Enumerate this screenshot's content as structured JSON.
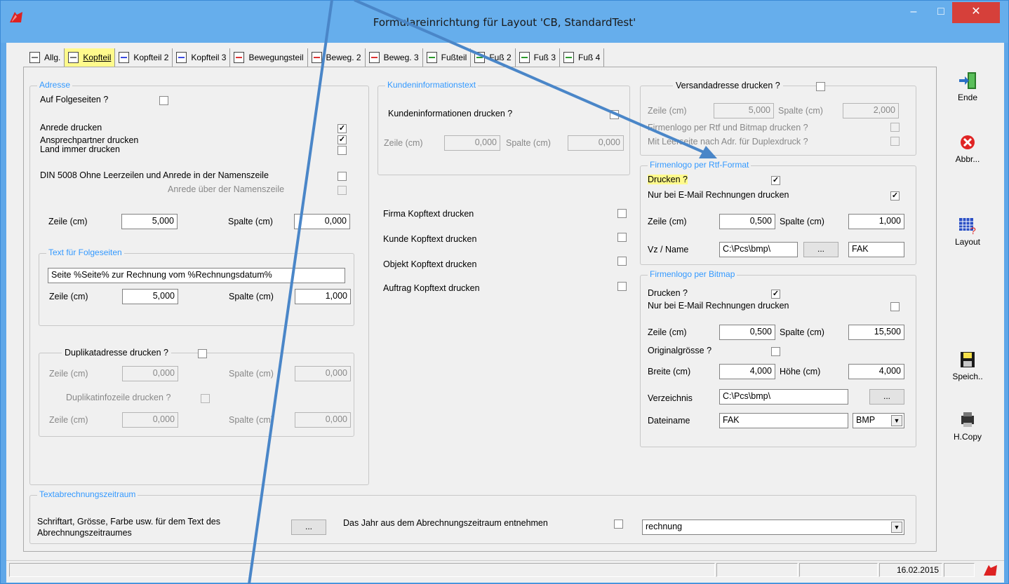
{
  "window": {
    "title": "Formulareinrichtung für Layout 'CB, StandardTest'",
    "min": "–",
    "max": "□",
    "close": "✕"
  },
  "tabs": [
    {
      "label": "Allg.",
      "icon": "white"
    },
    {
      "label": "Kopfteil",
      "icon": "white",
      "active": true
    },
    {
      "label": "Kopfteil 2",
      "icon": "blue"
    },
    {
      "label": "Kopfteil 3",
      "icon": "blue"
    },
    {
      "label": "Bewegungsteil",
      "icon": "red"
    },
    {
      "label": "Beweg. 2",
      "icon": "red"
    },
    {
      "label": "Beweg. 3",
      "icon": "red"
    },
    {
      "label": "Fußteil",
      "icon": "green"
    },
    {
      "label": "Fuß 2",
      "icon": "green"
    },
    {
      "label": "Fuß 3",
      "icon": "green"
    },
    {
      "label": "Fuß 4",
      "icon": "green"
    }
  ],
  "adresse": {
    "legend": "Adresse",
    "auf_folgeseiten": "Auf Folgeseiten ?",
    "anrede_drucken": "Anrede  drucken",
    "ansprechpartner": "Ansprechpartner drucken",
    "land_immer": "Land immer drucken",
    "din5008": "DIN 5008 Ohne Leerzeilen und Anrede in der Namenszeile",
    "anrede_ueber": "Anrede  über der Namenszeile",
    "zeile_label": "Zeile (cm)",
    "zeile": "5,000",
    "spalte_label": "Spalte (cm)",
    "spalte": "0,000"
  },
  "folgeseiten": {
    "legend": "Text für Folgeseiten",
    "text": "Seite %Seite% zur Rechnung vom %Rechnungsdatum%",
    "zeile_label": "Zeile (cm)",
    "zeile": "5,000",
    "spalte_label": "Spalte (cm)",
    "spalte": "1,000"
  },
  "duplikat": {
    "label": "Duplikatadresse drucken ?",
    "zeile_label": "Zeile  (cm)",
    "zeile": "0,000",
    "spalte_label": "Spalte (cm)",
    "spalte": "0,000",
    "info_label": "Duplikatinfozeile drucken ?",
    "zeile2": "0,000",
    "spalte2": "0,000"
  },
  "kundeninfo": {
    "legend": "Kundeninformationstext",
    "drucken": "Kundeninformationen drucken ?",
    "zeile_label": "Zeile (cm)",
    "zeile": "0,000",
    "spalte_label": "Spalte (cm)",
    "spalte": "0,000"
  },
  "kopftexte": [
    "Firma Kopftext drucken",
    "Kunde Kopftext drucken",
    "Objekt Kopftext drucken",
    "Auftrag Kopftext drucken"
  ],
  "versand": {
    "label": "Versandadresse drucken ?",
    "zeile_label": "Zeile  (cm)",
    "zeile": "5,000",
    "spalte_label": "Spalte (cm)",
    "spalte": "2,000",
    "rtf_bitmap": "Firmenlogo per Rtf und Bitmap drucken ?",
    "leerseite": "Mit Leerseite nach Adr. für Duplexdruck ?"
  },
  "rtf": {
    "legend": "Firmenlogo per Rtf-Format",
    "drucken": "Drucken ?",
    "email": "Nur bei E-Mail Rechnungen drucken",
    "zeile_label": "Zeile (cm)",
    "zeile": "0,500",
    "spalte_label": "Spalte (cm)",
    "spalte": "1,000",
    "vz_label": "Vz / Name",
    "vz": "C:\\Pcs\\bmp\\",
    "browse": "...",
    "name": "FAK"
  },
  "bitmap": {
    "legend": "Firmenlogo per Bitmap",
    "drucken": "Drucken ?",
    "email": "Nur bei E-Mail Rechnungen drucken",
    "zeile_label": "Zeile (cm)",
    "zeile": "0,500",
    "spalte_label": "Spalte (cm)",
    "spalte": "15,500",
    "original": "Originalgrösse ?",
    "breite_label": "Breite (cm)",
    "breite": "4,000",
    "hoehe_label": "Höhe (cm)",
    "hoehe": "4,000",
    "verz_label": "Verzeichnis",
    "verz": "C:\\Pcs\\bmp\\",
    "browse": "...",
    "datei_label": "Dateiname",
    "datei": "FAK",
    "ext": "BMP"
  },
  "zeitraum": {
    "legend": "Textabrechnungszeitraum",
    "schrift": "Schriftart, Grösse, Farbe usw. für dem Text des",
    "schrift2": "Abrechnungszeitraumes",
    "btn": "...",
    "jahr": "Das Jahr aus dem Abrechnungszeitraum entnehmen",
    "select": "rechnung"
  },
  "side": {
    "ende": "Ende",
    "abbr": "Abbr...",
    "layout": "Layout",
    "speich": "Speich..",
    "hcopy": "H.Copy"
  },
  "status": {
    "date": "16.02.2015"
  },
  "colors": {
    "titlebar": "#66aeec",
    "close": "#d6403a",
    "legend": "#3399ff",
    "arrow": "#4a86c8",
    "highlight": "#fffa8c"
  }
}
